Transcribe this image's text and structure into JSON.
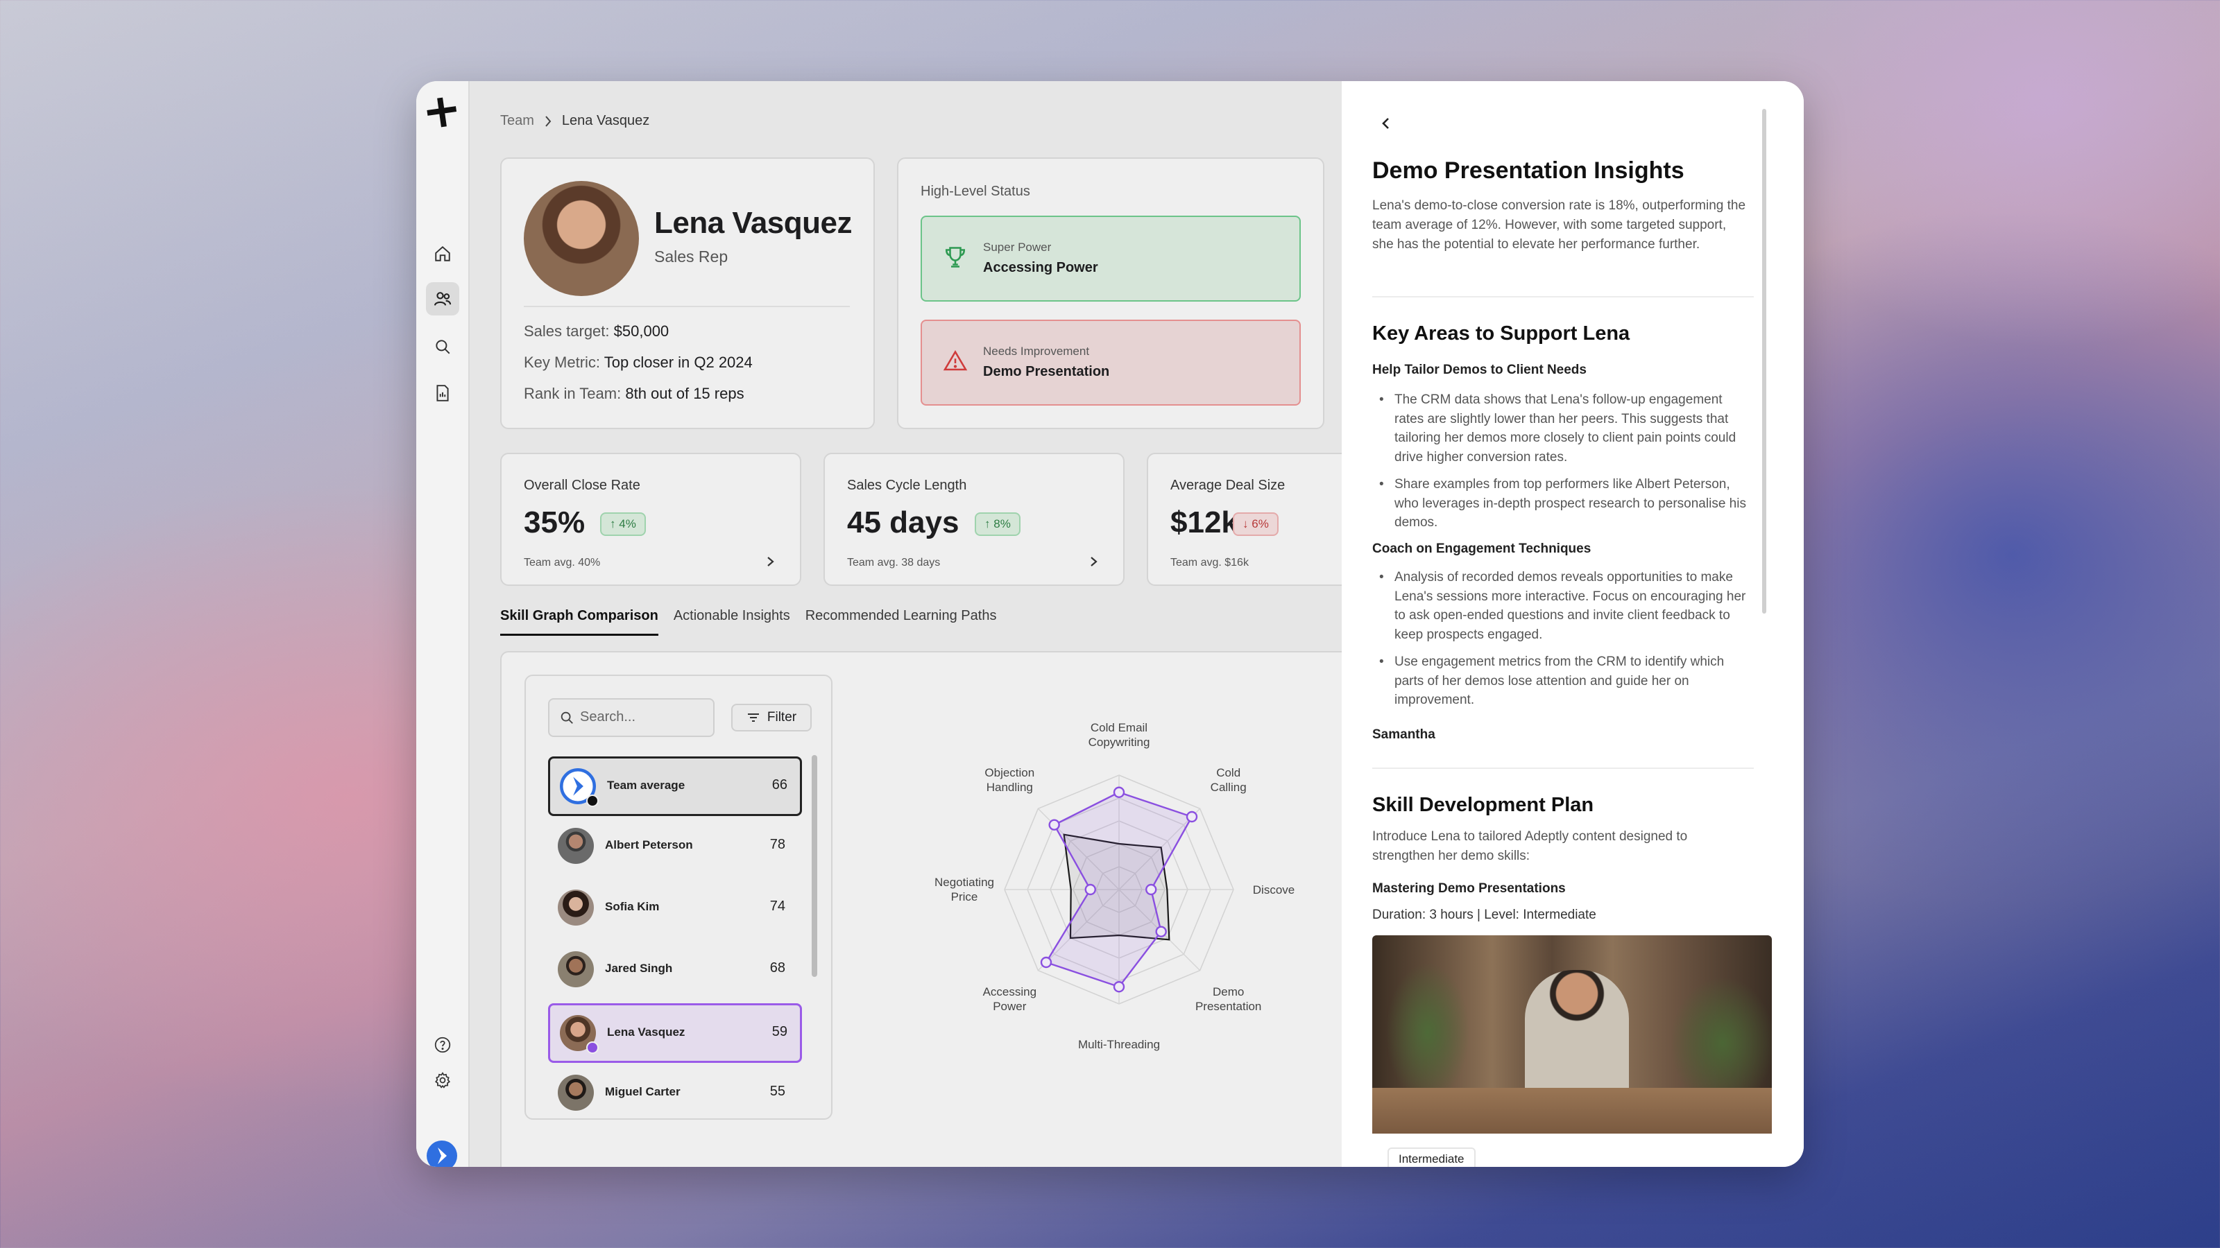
{
  "breadcrumb": {
    "parent": "Team",
    "current": "Lena Vasquez"
  },
  "profile": {
    "name": "Lena Vasquez",
    "role": "Sales Rep",
    "lines": [
      {
        "label": "Sales target: ",
        "value": "$50,000"
      },
      {
        "label": "Key Metric: ",
        "value": "Top closer in Q2 2024"
      },
      {
        "label": "Rank in Team: ",
        "value": "8th out of 15 reps"
      }
    ]
  },
  "status": {
    "heading": "High-Level Status",
    "good": {
      "caption": "Super Power",
      "title": "Accessing Power",
      "color": "#6cc489"
    },
    "bad": {
      "caption": "Needs Improvement",
      "title": "Demo Presentation",
      "color": "#e48f8f"
    }
  },
  "metrics": [
    {
      "title": "Overall Close Rate",
      "value": "35%",
      "change": "4%",
      "direction": "up",
      "avg": "Team avg. 40%"
    },
    {
      "title": "Sales Cycle Length",
      "value": "45 days",
      "change": "8%",
      "direction": "up",
      "avg": "Team avg. 38 days"
    },
    {
      "title": "Average Deal Size",
      "value": "$12k",
      "change": "6%",
      "direction": "down",
      "avg": "Team avg. $16k"
    }
  ],
  "tabs": [
    "Skill Graph Comparison",
    "Actionable Insights",
    "Recommended Learning Paths"
  ],
  "list": {
    "search_placeholder": "Search...",
    "filter_label": "Filter",
    "rows": [
      {
        "name": "Team average",
        "score": "66"
      },
      {
        "name": "Albert Peterson",
        "score": "78"
      },
      {
        "name": "Sofia Kim",
        "score": "74"
      },
      {
        "name": "Jared Singh",
        "score": "68"
      },
      {
        "name": "Lena Vasquez",
        "score": "59"
      },
      {
        "name": "Miguel Carter",
        "score": "55"
      }
    ]
  },
  "chart_data": {
    "type": "radar",
    "axes": [
      "Cold Email Copywriting",
      "Cold Calling",
      "Discovery",
      "Demo Presentation",
      "Multi-Threading",
      "Accessing Power",
      "Negotiating Price",
      "Objection Handling"
    ],
    "axis_label_lines": [
      [
        "Cold Email",
        "Copywriting"
      ],
      [
        "Cold",
        "Calling"
      ],
      [
        "Discove"
      ],
      [
        "Demo",
        "Presentation"
      ],
      [
        "Multi-Threading"
      ],
      [
        "Accessing",
        "Power"
      ],
      [
        "Negotiating",
        "Price"
      ],
      [
        "Objection",
        "Handling"
      ]
    ],
    "rmax": 1,
    "rings": 5,
    "series": [
      {
        "values": [
          0.4,
          0.52,
          0.42,
          0.62,
          0.4,
          0.6,
          0.42,
          0.68
        ],
        "color": "#1a1a1a"
      },
      {
        "values": [
          0.85,
          0.9,
          0.28,
          0.52,
          0.85,
          0.9,
          0.25,
          0.8
        ],
        "color": "#8a4fe0"
      }
    ]
  },
  "sheet": {
    "title": "Demo Presentation Insights",
    "intro": "Lena's demo-to-close conversion rate is 18%, outperforming the team average of 12%. However, with some targeted support, she has the potential to elevate her performance further.",
    "support_title": "Key Areas to Support Lena",
    "sub1": "Help Tailor Demos to Client Needs",
    "b1": "The CRM data shows that Lena's follow-up engagement rates are slightly lower than her peers. This suggests that tailoring her demos more closely to client pain points could drive higher conversion rates.",
    "b2": "Share examples from top performers like Albert Peterson, who leverages in-depth prospect research to personalise his demos.",
    "sub2": "Coach on Engagement Techniques",
    "b3": "Analysis of recorded demos reveals opportunities to make Lena's sessions more interactive. Focus on encouraging her to ask open-ended questions and invite client feedback to keep prospects engaged.",
    "b4": "Use engagement metrics from the CRM to identify which parts of her demos lose attention and guide her on improvement.",
    "signature": "Samantha",
    "plan_title": "Skill Development Plan",
    "plan_intro": "Introduce Lena to tailored Adeptly content designed to strengthen her demo skills:",
    "course_title": "Mastering Demo Presentations",
    "course_meta": "Duration: 3 hours | Level: Intermediate",
    "course_tag": "Intermediate"
  }
}
